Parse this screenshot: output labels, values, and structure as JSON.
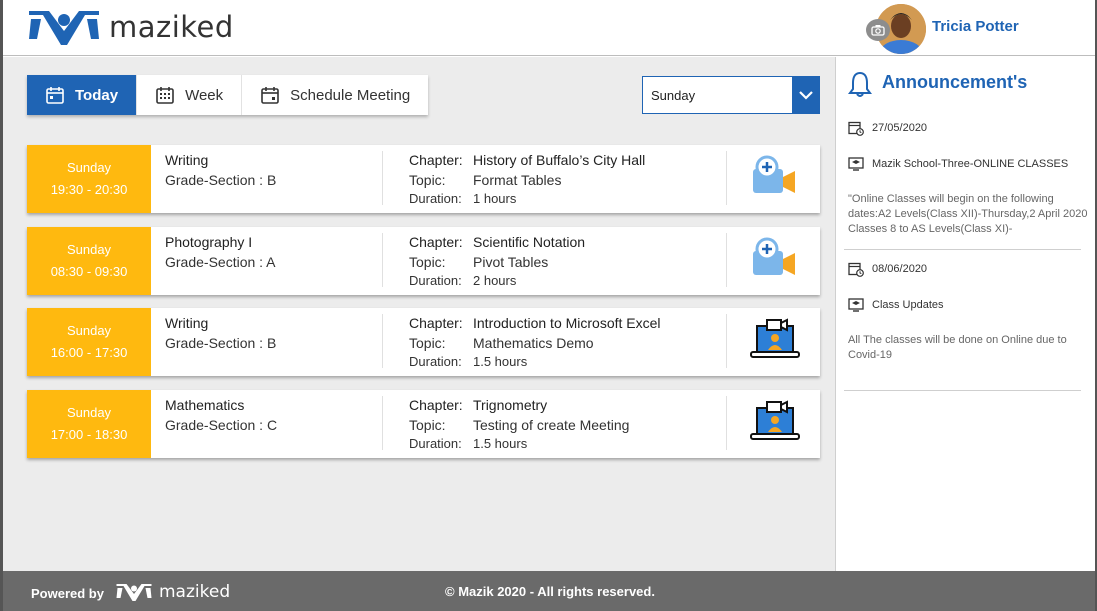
{
  "brand": {
    "name": "maziked"
  },
  "user": {
    "name": "Tricia Potter"
  },
  "tabs": [
    {
      "label": "Today",
      "icon": "calendar-icon",
      "active": true
    },
    {
      "label": "Week",
      "icon": "calendar-grid-icon",
      "active": false
    },
    {
      "label": "Schedule Meeting",
      "icon": "calendar-icon",
      "active": false
    }
  ],
  "day_select": {
    "value": "Sunday"
  },
  "labels": {
    "grade": "Grade-Section",
    "chapter": "Chapter:",
    "topic": "Topic:",
    "duration": "Duration:"
  },
  "schedule": [
    {
      "day": "Sunday",
      "time": "19:30 - 20:30",
      "subject": "Writing",
      "grade": ":  B",
      "chapter": "History of Buffalo’s City Hall",
      "topic": "Format Tables",
      "duration": "1  hours",
      "action_icon": "video-camera-add-icon"
    },
    {
      "day": "Sunday",
      "time": "08:30 - 09:30",
      "subject": "Photography I",
      "grade": ":  A",
      "chapter": "Scientific Notation",
      "topic": "Pivot Tables",
      "duration": "2  hours",
      "action_icon": "video-camera-add-icon"
    },
    {
      "day": "Sunday",
      "time": "16:00 - 17:30",
      "subject": "Writing",
      "grade": ":  B",
      "chapter": "Introduction to Microsoft Excel",
      "topic": "Mathematics Demo",
      "duration": "1.5  hours",
      "action_icon": "online-class-laptop-icon"
    },
    {
      "day": "Sunday",
      "time": "17:00 - 18:30",
      "subject": "Mathematics",
      "grade": ":  C",
      "chapter": "Trignometry",
      "topic": "Testing of create Meeting",
      "duration": "1.5  hours",
      "action_icon": "online-class-laptop-icon"
    }
  ],
  "announcements": {
    "title": "Announcement's",
    "items": [
      {
        "date": "27/05/2020",
        "source": "Mazik School-Three-ONLINE CLASSES",
        "text": "\"Online Classes will begin on the following dates:A2 Levels(Class XII)-Thursday,2 April 2020 Classes 8 to AS Levels(Class XI)-"
      },
      {
        "date": "08/06/2020",
        "source": "Class Updates",
        "text": "All The classes will be done on Online due to Covid-19"
      }
    ]
  },
  "footer": {
    "powered_by": "Powered by",
    "brand": "maziked",
    "copyright": "© Mazik 2020 - All rights reserved."
  },
  "colors": {
    "primary": "#1f64b4",
    "accent": "#ffb90f",
    "footer": "#6a6a6a"
  }
}
